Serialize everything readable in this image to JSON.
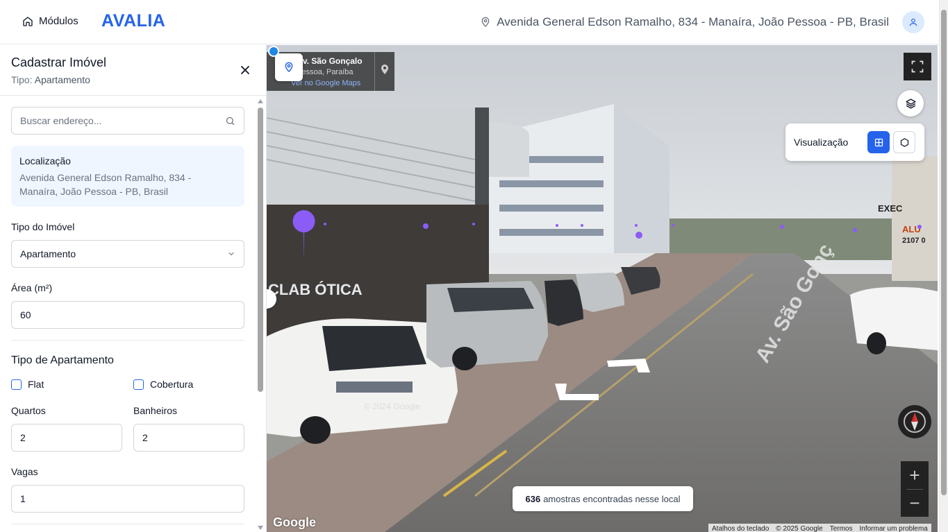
{
  "header": {
    "modules_label": "Módulos",
    "brand": "AVALIA",
    "address": "Avenida General Edson Ramalho, 834 - Manaíra, João Pessoa - PB, Brasil"
  },
  "sidebar": {
    "title": "Cadastrar Imóvel",
    "subtitle_prefix": "Tipo:",
    "subtitle_value": "Apartamento",
    "search_placeholder": "Buscar endereço...",
    "location": {
      "label": "Localização",
      "value": "Avenida General Edson Ramalho, 834 - Manaíra, João Pessoa - PB, Brasil"
    },
    "property_type": {
      "label": "Tipo do Imóvel",
      "value": "Apartamento"
    },
    "area": {
      "label": "Área (m²)",
      "value": "60"
    },
    "apartment_type": {
      "title": "Tipo de Apartamento",
      "options": [
        {
          "label": "Flat",
          "checked": false
        },
        {
          "label": "Cobertura",
          "checked": false
        }
      ]
    },
    "rooms": {
      "label": "Quartos",
      "value": "2"
    },
    "bathrooms": {
      "label": "Banheiros",
      "value": "2"
    },
    "parking": {
      "label": "Vagas",
      "value": "1"
    }
  },
  "map": {
    "streetview": {
      "street": "0 Av. São Gonçalo",
      "city": "o Pessoa, Paraíba",
      "google_maps_link": "Ver no Google Maps"
    },
    "visualization_label": "Visualização",
    "samples_count": "636",
    "samples_text": "amostras encontradas nesse local",
    "google_logo": "Google",
    "attribution": [
      "Atalhos do teclado",
      "© 2025 Google",
      "Termos",
      "Informar um problema"
    ],
    "zoom_in": "+",
    "zoom_out": "−",
    "scene_texts": {
      "storefront": "CLAB ÓTICA",
      "road": "Av. São Gonç",
      "sign_1": "EXEC",
      "sign_2": "ALU",
      "sign_3": "2107 0",
      "watermark": "© 2024 Google"
    }
  },
  "colors": {
    "brand": "#2563eb",
    "accent_bg": "#eff6ff",
    "marker": "#8b5cf6"
  }
}
